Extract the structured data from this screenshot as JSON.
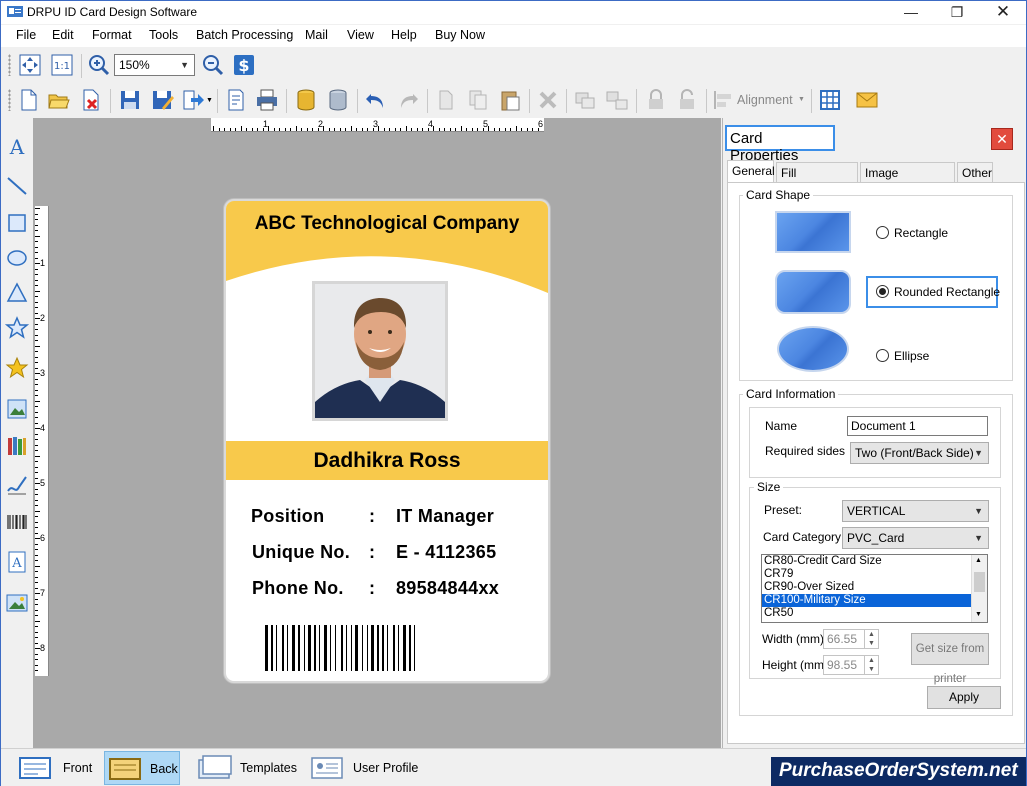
{
  "window": {
    "title": "DRPU ID Card Design Software",
    "controls": [
      "minimize",
      "restore",
      "close"
    ]
  },
  "menu": [
    "File",
    "Edit",
    "Format",
    "Tools",
    "Batch Processing",
    "Mail",
    "View",
    "Help",
    "Buy Now"
  ],
  "toolbar": {
    "zoom_value": "150%",
    "alignment_label": "Alignment"
  },
  "ruler": {
    "h_numbers": [
      "1",
      "2",
      "3",
      "4",
      "5",
      "6"
    ],
    "v_numbers": [
      "1",
      "2",
      "3",
      "4",
      "5",
      "6",
      "7",
      "8"
    ]
  },
  "card": {
    "company": "ABC Technological Company",
    "name": "Dadhikra Ross",
    "fields": [
      {
        "label": "Position",
        "colon": ":",
        "value": "IT Manager"
      },
      {
        "label": "Unique No.",
        "colon": ":",
        "value": "E - 4112365"
      },
      {
        "label": "Phone No.",
        "colon": ":",
        "value": "89584844xx"
      }
    ],
    "colors": {
      "header": "#f8c94b",
      "namebar": "#f8c94b"
    }
  },
  "panel": {
    "title": "Card Properties",
    "close": "✕",
    "tabs": [
      "General",
      "Fill Background",
      "Image Processing",
      "Other"
    ],
    "card_shape": {
      "label": "Card Shape",
      "options": [
        "Rectangle",
        "Rounded Rectangle",
        "Ellipse"
      ],
      "selected": "Rounded Rectangle"
    },
    "card_info": {
      "label": "Card Information",
      "name_label": "Name",
      "name_value": "Document 1",
      "sides_label": "Required sides",
      "sides_value": "Two (Front/Back Side)"
    },
    "size": {
      "label": "Size",
      "preset_label": "Preset:",
      "preset_value": "VERTICAL",
      "category_label": "Card Category",
      "category_value": "PVC_Card",
      "list": [
        "CR80-Credit Card Size",
        "CR79",
        "CR90-Over Sized",
        "CR100-Military Size",
        "CR50"
      ],
      "list_selected": "CR100-Military Size",
      "width_label": "Width  (mm)",
      "width_value": "66.55",
      "height_label": "Height  (mm)",
      "height_value": "98.55",
      "printer_button": "Get size from printer",
      "apply_button": "Apply"
    }
  },
  "bottom_tabs": [
    "Front",
    "Back",
    "Templates",
    "User Profile"
  ],
  "active_bottom_tab": "Back",
  "watermark": "PurchaseOrderSystem.net"
}
